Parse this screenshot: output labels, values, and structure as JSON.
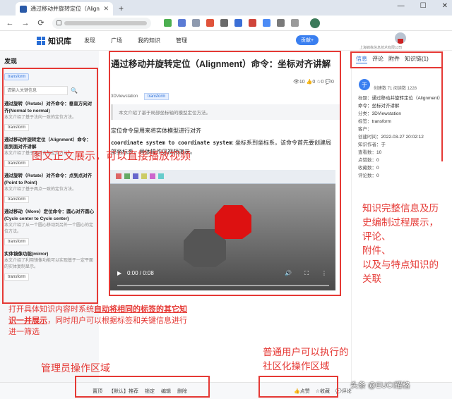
{
  "browser": {
    "tab_title": "通过移动并旋转定位（Alignment",
    "window_controls": [
      "—",
      "☐",
      "✕"
    ],
    "nav": [
      "←",
      "→",
      "⟳"
    ]
  },
  "header": {
    "brand": "知识库",
    "menu": [
      "发现",
      "广场",
      "我的知识",
      "管理"
    ],
    "contribute_label": "贡献+",
    "org": "上海锦栋信息技术有限公司"
  },
  "sidebar": {
    "title": "发现",
    "filter_tag": "transform",
    "search_placeholder": "请输入关键信息",
    "items": [
      {
        "title": "通过旋转（Rotate）对齐命令：垂直方向对齐(Normal to normal)",
        "desc": "本文介绍了基于法向一致的定位方法。",
        "tag": "transform"
      },
      {
        "title": "通过移动并旋转定位（Alignment）命令：面到面对齐讲解",
        "desc": "本文介绍了基于面对齐的定位方法。",
        "tag": "transform"
      },
      {
        "title": "通过旋转（Rotate）对齐命令：点到点对齐(Point to Point)",
        "desc": "本文介绍了基于两点一致的定位方法。",
        "tag": "transform"
      },
      {
        "title": "通过移动（Move）定位命令：圆心对齐圆心(Cycle center to Cycle center)",
        "desc": "本文介绍了从一个圆心移动到另外一个圆心的定位方法。",
        "tag": "transform"
      },
      {
        "title": "实体镜像功能(mirror)",
        "desc": "本文介绍了利用镜像功能可以实现基于一定平面的实体复制显示。",
        "tag": "transform"
      }
    ]
  },
  "article": {
    "title": "通过移动并旋转定位（Alignment）命令：坐标对齐讲解",
    "stats": "👁10 👍0 ☆0 💬0",
    "category": "3DViewstation",
    "tag": "transform",
    "summary": "本文介绍了基于局部坐标轴的模型定位方法。",
    "body_line1": "定位命令是用来将实体模型进行对齐",
    "body_code": "coordinate system to coordinate system",
    "body_rest": ": 坐标系到坐标系，该命令首先要创建局部坐标系，具体操作见视频演示。",
    "video_time": "0:00 / 0:08"
  },
  "detail": {
    "tabs": [
      "信息",
      "评论",
      "附件",
      "知识链(1)"
    ],
    "avatar_letter": "于",
    "meta": "创建数 71   阅读数 1228",
    "rows": [
      {
        "k": "标题：",
        "v": "通过移动并旋转定位（Alignment）命令：坐标对齐讲解"
      },
      {
        "k": "分类：",
        "v": "3DViewstation"
      },
      {
        "k": "标签：",
        "v": "transform"
      },
      {
        "k": "客户：",
        "v": ""
      },
      {
        "k": "创建时间：",
        "v": "2022-03-27 20:02:12"
      },
      {
        "k": "知识作者：",
        "v": "于"
      },
      {
        "k": "查看数：",
        "v": "10"
      },
      {
        "k": "点赞数：",
        "v": "0"
      },
      {
        "k": "收藏数：",
        "v": "0"
      },
      {
        "k": "评论数：",
        "v": "0"
      }
    ]
  },
  "bottom": {
    "admin_actions": [
      "置顶",
      "【默认】推荐",
      "锁定",
      "编辑",
      "删除"
    ],
    "user_actions": [
      "👍点赞",
      "☆收藏",
      "💬评论"
    ]
  },
  "annotations": {
    "video": "图文正文展示，可以直接播放视频",
    "right": "知识完整信息及历史编制过程展示，\n评论、\n附件、\n以及与特点知识的关联",
    "left_pre": "打开具体知识内容时系统",
    "left_bold": "自动将相同的标签的其它知识一并展示",
    "left_post": "，同时用户可以根据标签和关键信息进行进一筛选",
    "admin": "管理员操作区域",
    "user": "普通用户可以执行的\n社区化操作区域"
  },
  "watermark": "头条 @EUCI耀格",
  "colors": {
    "accent": "#2a6fd6",
    "annotation": "#e53935",
    "button": "#3a7ff0"
  }
}
